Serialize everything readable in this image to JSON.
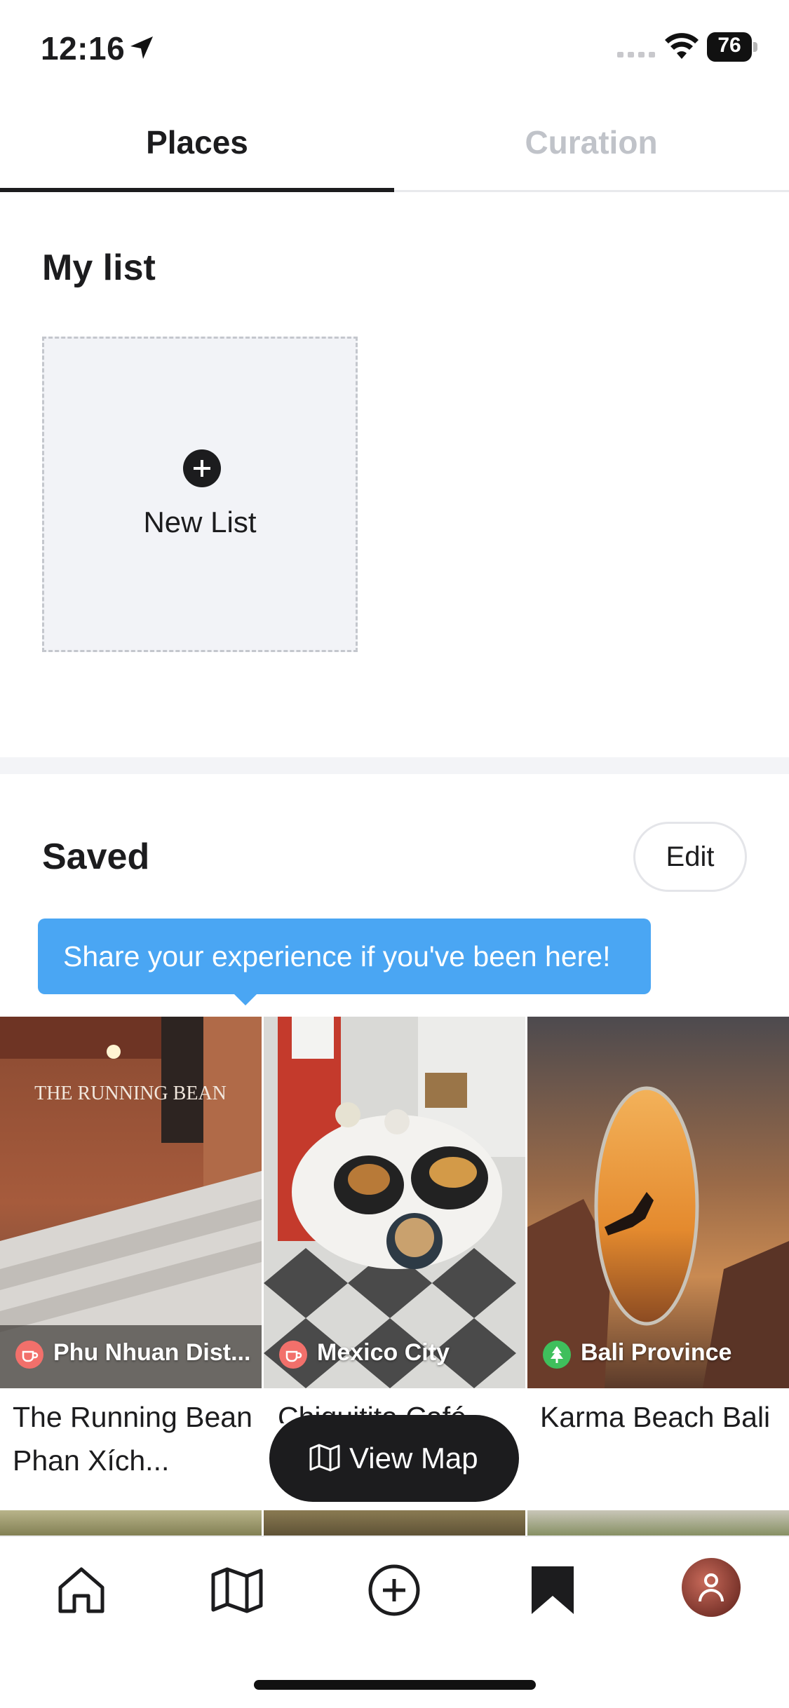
{
  "status_bar": {
    "time": "12:16",
    "battery": "76"
  },
  "tabs": [
    {
      "label": "Places"
    },
    {
      "label": "Curation"
    }
  ],
  "my_list": {
    "title": "My list",
    "new_list_label": "New List"
  },
  "saved": {
    "title": "Saved",
    "edit_label": "Edit",
    "tooltip": "Share your experience if you've been here!",
    "items": [
      {
        "location": "Phu Nhuan Dist...",
        "title": "The Running Bean Phan Xích...",
        "category_icon": "coffee-icon"
      },
      {
        "location": "Mexico City",
        "title": "Chiquitita Café",
        "category_icon": "coffee-icon"
      },
      {
        "location": "Bali Province",
        "title": "Karma Beach Bali",
        "category_icon": "tree-icon"
      }
    ]
  },
  "view_map_label": "View Map",
  "colors": {
    "accent_blue": "#4aa6f3",
    "dark": "#1c1c1e",
    "cafe_badge": "#f2706b",
    "nature_badge": "#3fbf5c"
  }
}
